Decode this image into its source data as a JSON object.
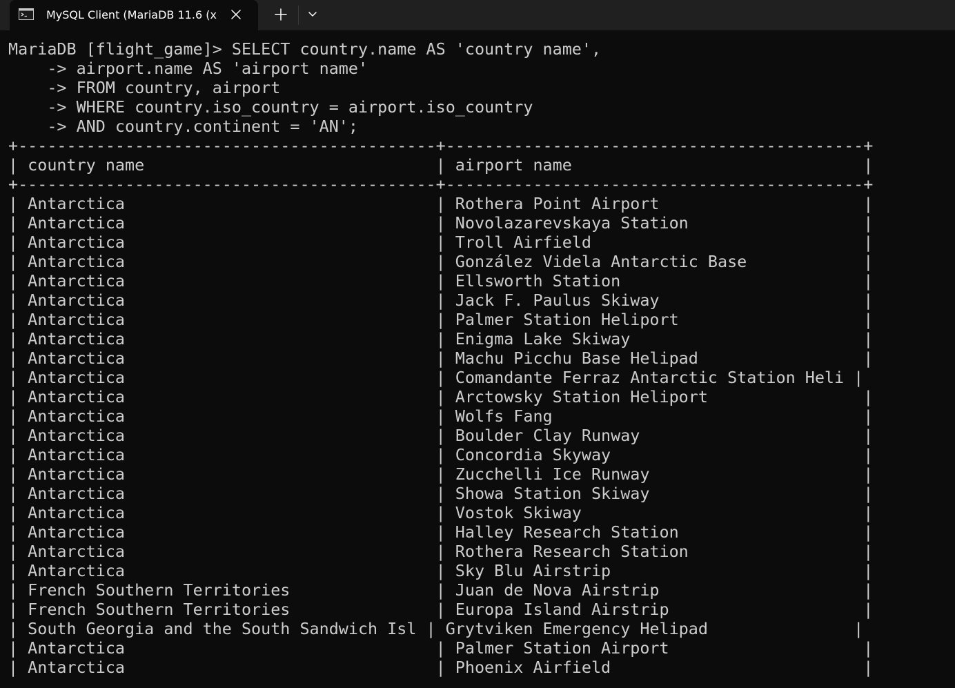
{
  "window": {
    "tab_title": "MySQL Client (MariaDB 11.6 (x",
    "icons": [
      "terminal-icon",
      "close-icon",
      "plus-icon",
      "chevron-down-icon"
    ],
    "colors": {
      "background": "#0c0c0c",
      "tabbar": "#202020",
      "text": "#cccccc"
    }
  },
  "terminal": {
    "lines": [
      "MariaDB [flight_game]> SELECT country.name AS 'country name',",
      "    -> airport.name AS 'airport name'",
      "    -> FROM country, airport",
      "    -> WHERE country.iso_country = airport.iso_country",
      "    -> AND country.continent = 'AN';",
      "+-------------------------------------------+-------------------------------------------+",
      "| country name                              | airport name                              |",
      "+-------------------------------------------+-------------------------------------------+",
      "| Antarctica                                | Rothera Point Airport                     |",
      "| Antarctica                                | Novolazarevskaya Station                  |",
      "| Antarctica                                | Troll Airfield                            |",
      "| Antarctica                                | González Videla Antarctic Base            |",
      "| Antarctica                                | Ellsworth Station                         |",
      "| Antarctica                                | Jack F. Paulus Skiway                     |",
      "| Antarctica                                | Palmer Station Heliport                   |",
      "| Antarctica                                | Enigma Lake Skiway                        |",
      "| Antarctica                                | Machu Picchu Base Helipad                 |",
      "| Antarctica                                | Comandante Ferraz Antarctic Station Heli |",
      "| Antarctica                                | Arctowsky Station Heliport                |",
      "| Antarctica                                | Wolfs Fang                                |",
      "| Antarctica                                | Boulder Clay Runway                       |",
      "| Antarctica                                | Concordia Skyway                          |",
      "| Antarctica                                | Zucchelli Ice Runway                      |",
      "| Antarctica                                | Showa Station Skiway                      |",
      "| Antarctica                                | Vostok Skiway                             |",
      "| Antarctica                                | Halley Research Station                   |",
      "| Antarctica                                | Rothera Research Station                  |",
      "| Antarctica                                | Sky Blu Airstrip                          |",
      "| French Southern Territories               | Juan de Nova Airstrip                     |",
      "| French Southern Territories               | Europa Island Airstrip                    |",
      "| South Georgia and the South Sandwich Isl | Grytviken Emergency Helipad               |",
      "| Antarctica                                | Palmer Station Airport                    |",
      "| Antarctica                                | Phoenix Airfield                          |"
    ]
  }
}
